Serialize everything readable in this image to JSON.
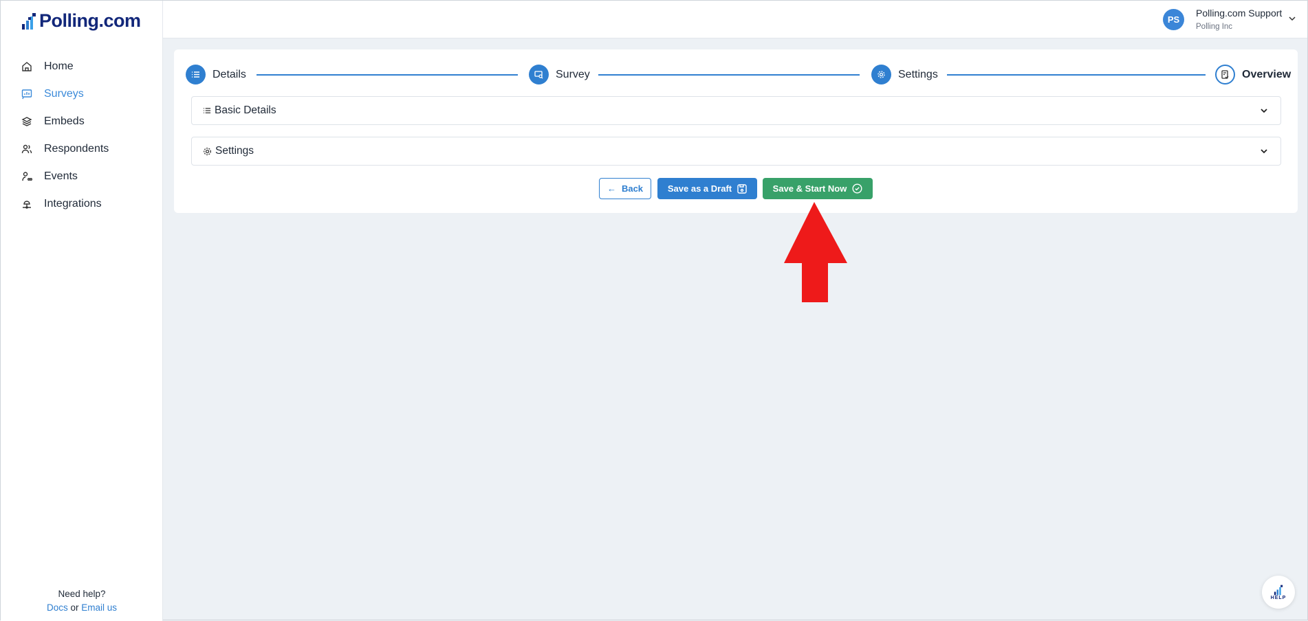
{
  "brand": {
    "name": "Polling.com",
    "color": "#12277a"
  },
  "sidebar": {
    "items": [
      {
        "label": "Home",
        "icon": "home-icon"
      },
      {
        "label": "Surveys",
        "icon": "survey-icon",
        "active": true
      },
      {
        "label": "Embeds",
        "icon": "layers-icon"
      },
      {
        "label": "Respondents",
        "icon": "users-icon"
      },
      {
        "label": "Events",
        "icon": "event-icon"
      },
      {
        "label": "Integrations",
        "icon": "integrations-icon"
      }
    ],
    "help": {
      "title": "Need help?",
      "docs": "Docs",
      "or": "or",
      "email": "Email us"
    }
  },
  "header": {
    "avatar_initials": "PS",
    "user_name": "Polling.com Support",
    "org": "Polling Inc"
  },
  "stepper": {
    "steps": [
      {
        "label": "Details"
      },
      {
        "label": "Survey"
      },
      {
        "label": "Settings"
      },
      {
        "label": "Overview",
        "current": true
      }
    ]
  },
  "accordions": [
    {
      "label": "Basic Details"
    },
    {
      "label": "Settings"
    }
  ],
  "actions": {
    "back": "Back",
    "draft": "Save as a Draft",
    "start": "Save & Start Now"
  },
  "help_widget": {
    "label": "HELP"
  },
  "colors": {
    "primary": "#2f7fd0",
    "success": "#38a169",
    "annotation_arrow": "#ee1a1a",
    "background": "#edf1f5"
  }
}
